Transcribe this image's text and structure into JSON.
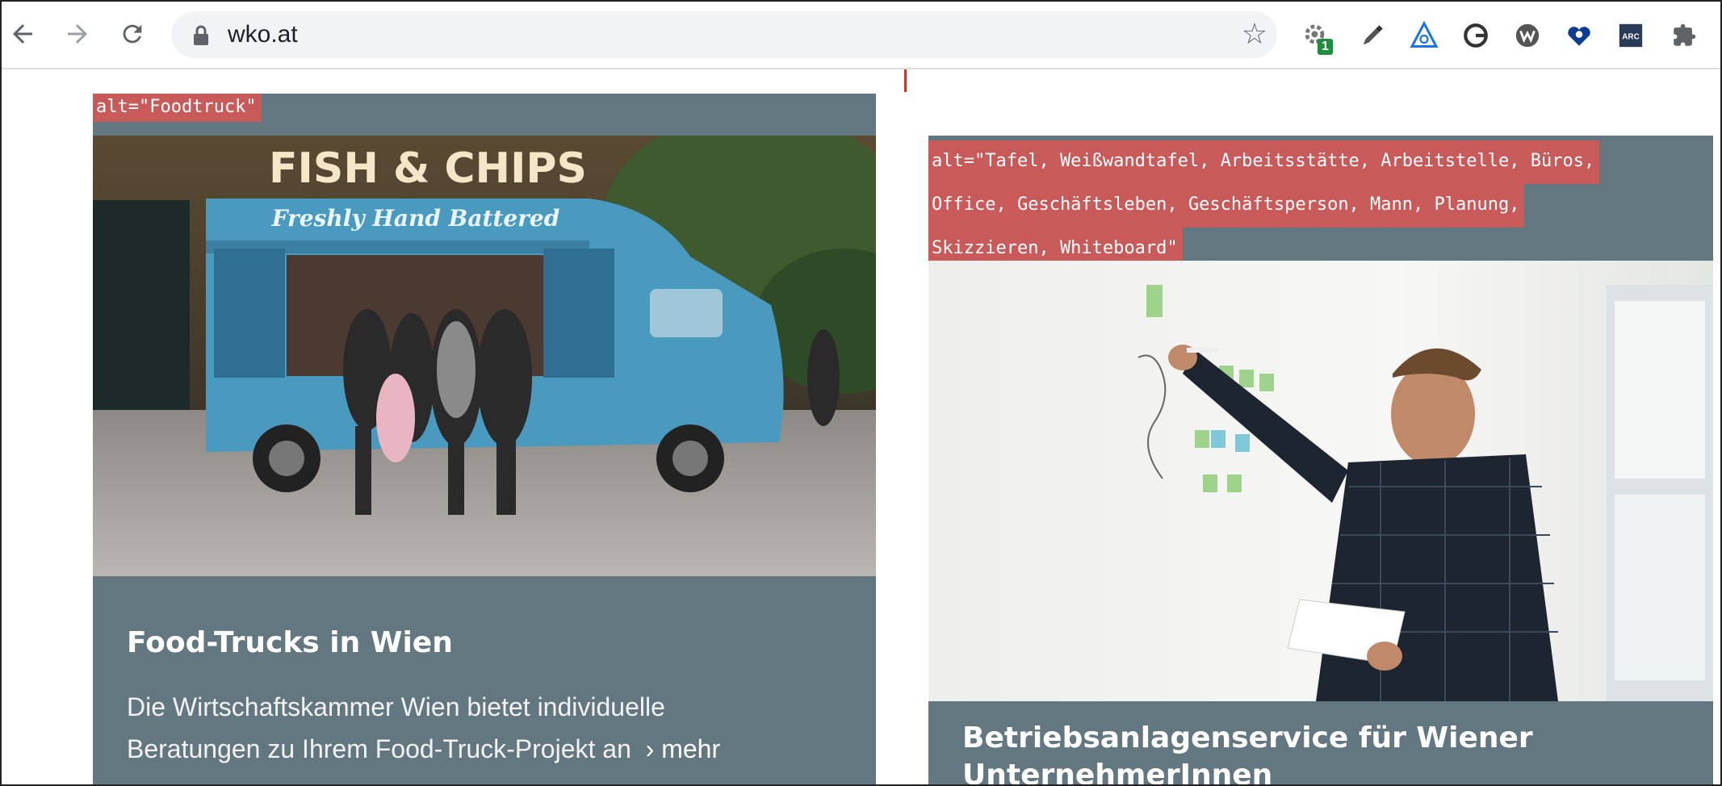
{
  "browser": {
    "url": "wko.at",
    "extension_badge": "1",
    "icons": [
      "back-arrow-icon",
      "forward-arrow-icon",
      "reload-icon",
      "lock-icon",
      "bookmark-star-icon",
      "settings-gear-extension-icon",
      "eyedropper-icon",
      "accessibility-triangle-icon",
      "g-circle-icon",
      "wappalyzer-icon",
      "heart-magnifier-icon",
      "arc-icon",
      "puzzle-extensions-icon"
    ],
    "extensions": {
      "arc_label": "ARC"
    }
  },
  "cards": [
    {
      "alt_lines": [
        "alt=\"Foodtruck\""
      ],
      "image_desc": "",
      "title": "Food-Trucks in Wien",
      "desc_line1": "Die Wirtschaftskammer Wien bietet individuelle",
      "desc_line2": "Beratungen zu Ihrem Food-Truck-Projekt an",
      "more_label": "mehr"
    },
    {
      "alt_lines": [
        "alt=\"Tafel, Weißwandtafel, Arbeitsstätte, Arbeitstelle, Büros,",
        "Office, Geschäftsleben, Geschäftsperson, Mann, Planung,",
        "Skizzieren, Whiteboard\""
      ],
      "title_line1": "Betriebsanlagenservice für Wiener",
      "title_line2": "UnternehmerInnen"
    }
  ],
  "food_truck_sign": "FISH & CHIPS",
  "food_truck_subsign": "Freshly Hand Battered",
  "colors": {
    "card_bg": "#637780",
    "alt_bg": "#c95a5a",
    "toolbar_bg": "#ffffff",
    "omnibox_bg": "#f1f3f4"
  }
}
